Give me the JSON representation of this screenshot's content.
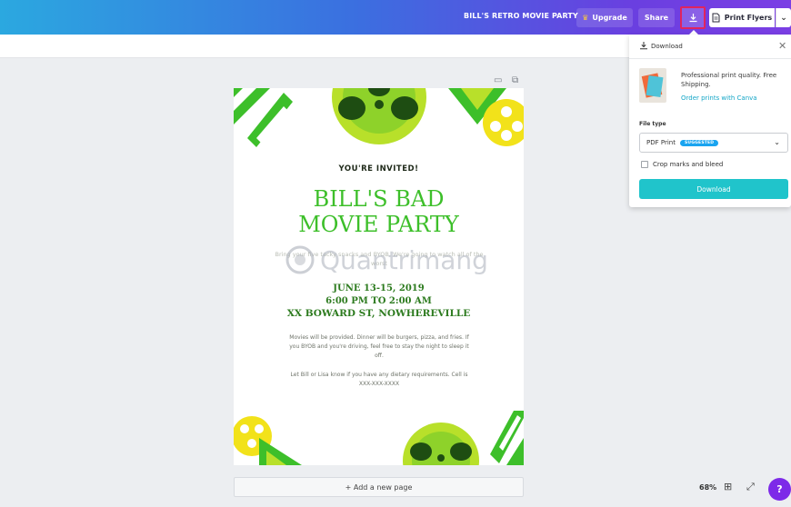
{
  "topbar": {
    "title": "BILL'S RETRO MOVIE PARTY",
    "upgrade_label": "Upgrade",
    "share_label": "Share",
    "print_label": "Print Flyers",
    "icons": [
      "crown-icon",
      "download-icon",
      "document-icon",
      "chevron-down-icon"
    ]
  },
  "poster": {
    "invited": "YOU'RE INVITED!",
    "title_line1": "BILL'S BAD",
    "title_line2": "MOVIE PARTY",
    "faint_text": "Bring your five tacky snacks and BYOB. We're going to watch all of the worst",
    "date": "JUNE 13-15, 2019",
    "time": "6:00 PM TO 2:00 AM",
    "address": "XX BOWARD ST, NOWHEREVILLE",
    "body1": "Movies will be provided. Dinner will be burgers, pizza, and fries. If you BYOB and you're driving, feel free to stay the night to sleep it off.",
    "body2": "Let Bill or Lisa know if you have any dietary requirements. Cell is XXX-XXX-XXXX",
    "colors": {
      "green": "#3dbf2a",
      "lime": "#b8e02a",
      "yellow": "#f2e21a",
      "dark_green": "#2d7b1f"
    }
  },
  "watermark": "Quantrimang",
  "add_page_label": "+ Add a new page",
  "zoom": {
    "level": "68%"
  },
  "help_label": "?",
  "download_panel": {
    "title": "Download",
    "promo_text": "Professional print quality. Free Shipping.",
    "promo_link": "Order prints with Canva",
    "file_type_label": "File type",
    "file_type_value": "PDF Print",
    "suggested_badge": "SUGGESTED",
    "crop_label": "Crop marks and bleed",
    "crop_checked": false,
    "button_label": "Download"
  }
}
